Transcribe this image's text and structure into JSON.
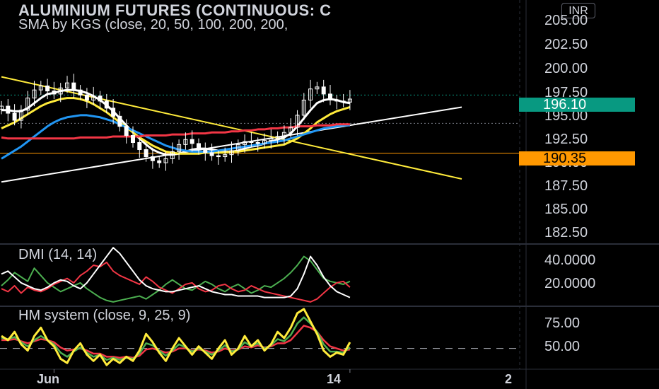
{
  "header": {
    "title": "ALUMINIUM FUTURES (CONTINUOUS: C",
    "indicator": "SMA by KGS (close, 20, 50, 100, 200, 200,",
    "currency": "INR"
  },
  "colors": {
    "background": "#000000",
    "candle": "#ffffff",
    "sma_white": "#ffffff",
    "sma_yellow": "#ffeb3b",
    "sma_blue": "#2196f3",
    "sma_red": "#f23645",
    "trendline_white": "#ffffff",
    "trendline_yellow": "#ffeb3b",
    "level_orange": "#ff9800",
    "last_price_teal": "#089981",
    "dmi_plus": "#4caf50",
    "dmi_minus": "#f23645",
    "adx": "#ffffff",
    "hm_fast": "#ffeb3b",
    "hm_mid": "#4caf50",
    "hm_slow": "#f23645"
  },
  "chart_data": [
    {
      "type": "candlestick",
      "pane": "price",
      "y_ticks": [
        "205.00",
        "202.50",
        "200.00",
        "197.50",
        "195.00",
        "192.50",
        "190.00",
        "187.50",
        "185.00",
        "182.50"
      ],
      "ylim": [
        181.5,
        205.5
      ],
      "last_price": "196.10",
      "last_price_value": 196.1,
      "level": "190.35",
      "level_value": 190.35,
      "close": [
        195.0,
        194.3,
        193.6,
        194.6,
        195.8,
        196.6,
        197.0,
        196.5,
        196.2,
        196.8,
        197.3,
        196.6,
        196.1,
        195.6,
        196.0,
        195.5,
        194.8,
        194.0,
        193.0,
        192.1,
        191.4,
        190.7,
        190.0,
        189.6,
        189.4,
        189.8,
        190.5,
        191.2,
        191.7,
        191.3,
        190.7,
        190.4,
        190.1,
        190.0,
        190.2,
        190.6,
        191.2,
        191.5,
        191.4,
        191.3,
        191.6,
        191.8,
        192.0,
        192.4,
        192.9,
        194.1,
        195.6,
        196.7,
        196.9,
        196.2,
        195.6,
        195.5,
        195.4,
        195.7
      ],
      "trendlines": [
        {
          "color": "white",
          "points": [
            [
              0,
              187.5
            ],
            [
              70,
              194.9
            ]
          ]
        },
        {
          "color": "yellow",
          "points": [
            [
              0,
              197.9
            ],
            [
              70,
              187.8
            ]
          ]
        }
      ],
      "sma_lines": [
        {
          "color": "white",
          "values": [
            194.6,
            194.6,
            194.5,
            194.5,
            194.8,
            195.3,
            195.8,
            196.2,
            196.3,
            196.5,
            196.6,
            196.6,
            196.5,
            196.3,
            196.0,
            195.6,
            195.1,
            194.5,
            193.8,
            193.1,
            192.4,
            191.8,
            191.2,
            190.7,
            190.4,
            190.2,
            190.2,
            190.3,
            190.5,
            190.7,
            190.8,
            190.8,
            190.7,
            190.6,
            190.5,
            190.5,
            190.6,
            190.8,
            191.0,
            191.1,
            191.3,
            191.5,
            191.7,
            191.9,
            192.3,
            193.0,
            193.8,
            194.6,
            195.3,
            195.6,
            195.7,
            195.6,
            195.4,
            195.3
          ]
        },
        {
          "color": "yellow",
          "values": [
            192.8,
            193.1,
            193.4,
            193.8,
            194.2,
            194.6,
            195.0,
            195.3,
            195.5,
            195.7,
            195.8,
            195.8,
            195.7,
            195.5,
            195.2,
            194.8,
            194.4,
            193.9,
            193.4,
            192.9,
            192.4,
            191.9,
            191.5,
            191.1,
            190.8,
            190.5,
            190.4,
            190.3,
            190.3,
            190.3,
            190.3,
            190.4,
            190.4,
            190.4,
            190.4,
            190.5,
            190.5,
            190.6,
            190.7,
            190.8,
            190.9,
            191.0,
            191.1,
            191.2,
            191.5,
            191.8,
            192.3,
            192.8,
            193.4,
            193.8,
            194.2,
            194.5,
            194.7,
            194.9
          ]
        },
        {
          "color": "blue",
          "values": [
            189.8,
            190.2,
            190.6,
            191.0,
            191.5,
            192.0,
            192.5,
            193.0,
            193.4,
            193.7,
            193.9,
            194.0,
            194.1,
            194.1,
            194.0,
            193.9,
            193.7,
            193.5,
            193.2,
            192.9,
            192.6,
            192.3,
            192.0,
            191.7,
            191.4,
            191.1,
            190.9,
            190.7,
            190.6,
            190.5,
            190.5,
            190.5,
            190.5,
            190.6,
            190.7,
            190.8,
            190.9,
            191.0,
            191.1,
            191.2,
            191.3,
            191.4,
            191.5,
            191.6,
            191.8,
            192.0,
            192.2,
            192.4,
            192.6,
            192.8,
            192.9,
            193.0,
            193.1,
            193.1
          ]
        },
        {
          "color": "red",
          "values": [
            191.9,
            191.8,
            191.8,
            191.8,
            191.8,
            191.8,
            191.8,
            191.8,
            191.8,
            191.8,
            191.8,
            191.8,
            191.9,
            191.9,
            191.9,
            191.9,
            191.9,
            192.0,
            192.0,
            192.0,
            192.0,
            192.0,
            192.1,
            192.1,
            192.1,
            192.1,
            192.2,
            192.2,
            192.2,
            192.3,
            192.3,
            192.3,
            192.4,
            192.4,
            192.4,
            192.5,
            192.5,
            192.6,
            192.6,
            192.7,
            192.7,
            192.8,
            192.8,
            192.9,
            192.9,
            193.0,
            193.0,
            193.0,
            193.1,
            193.1,
            193.1,
            193.2,
            193.2,
            193.2
          ]
        }
      ]
    },
    {
      "type": "line",
      "pane": "dmi",
      "title": "DMI (14, 14)",
      "y_ticks": [
        "40.0000",
        "20.0000"
      ],
      "ylim": [
        11,
        52
      ],
      "series": [
        {
          "color": "green",
          "values": [
            24,
            28,
            33,
            30,
            27,
            36,
            31,
            26,
            23,
            20,
            22,
            24,
            26,
            22,
            19,
            16,
            14,
            13,
            14,
            15,
            16,
            17,
            15,
            18,
            21,
            25,
            28,
            25,
            22,
            21,
            24,
            27,
            25,
            22,
            20,
            23,
            25,
            22,
            19,
            21,
            24,
            23,
            26,
            29,
            33,
            38,
            44,
            41,
            35,
            29,
            27,
            26,
            25,
            27
          ]
        },
        {
          "color": "red",
          "values": [
            22,
            20,
            24,
            19,
            23,
            21,
            20,
            22,
            25,
            27,
            29,
            26,
            31,
            34,
            38,
            37,
            40,
            34,
            31,
            29,
            27,
            25,
            30,
            27,
            23,
            21,
            19,
            22,
            25,
            26,
            22,
            20,
            21,
            24,
            25,
            22,
            20,
            21,
            24,
            22,
            20,
            19,
            18,
            17,
            16,
            15,
            14,
            13,
            15,
            19,
            23,
            26,
            27,
            23
          ]
        },
        {
          "color": "white",
          "values": [
            32,
            34,
            30,
            26,
            24,
            22,
            21,
            23,
            26,
            28,
            27,
            24,
            22,
            26,
            32,
            38,
            44,
            50,
            46,
            40,
            34,
            28,
            24,
            22,
            21,
            20,
            20,
            21,
            22,
            23,
            24,
            22,
            20,
            19,
            18,
            18,
            17,
            17,
            17,
            17,
            16,
            16,
            16,
            16,
            17,
            22,
            32,
            44,
            38,
            30,
            24,
            20,
            18,
            16
          ]
        }
      ]
    },
    {
      "type": "line",
      "pane": "hm",
      "title": "HM system (close, 9, 25, 9)",
      "y_ticks": [
        "75.00",
        "50.00"
      ],
      "ylim": [
        30,
        90
      ],
      "reference_line": 50,
      "series": [
        {
          "color": "yellow",
          "values": [
            62,
            58,
            66,
            54,
            48,
            62,
            70,
            58,
            52,
            40,
            36,
            48,
            55,
            44,
            38,
            44,
            34,
            40,
            36,
            42,
            38,
            48,
            64,
            56,
            46,
            38,
            50,
            60,
            52,
            44,
            52,
            46,
            40,
            50,
            58,
            44,
            50,
            62,
            52,
            58,
            48,
            54,
            66,
            60,
            70,
            84,
            88,
            76,
            64,
            48,
            42,
            46,
            44,
            56
          ]
        },
        {
          "color": "green",
          "values": [
            60,
            59,
            61,
            56,
            52,
            58,
            62,
            58,
            54,
            46,
            42,
            47,
            51,
            46,
            42,
            44,
            39,
            41,
            39,
            41,
            40,
            45,
            55,
            53,
            48,
            43,
            48,
            54,
            51,
            47,
            50,
            47,
            44,
            48,
            53,
            47,
            49,
            56,
            52,
            55,
            50,
            53,
            59,
            57,
            63,
            74,
            80,
            74,
            66,
            54,
            47,
            47,
            46,
            51
          ]
        },
        {
          "color": "red",
          "values": [
            58,
            58,
            59,
            57,
            55,
            57,
            59,
            58,
            56,
            51,
            48,
            49,
            50,
            48,
            45,
            45,
            42,
            42,
            41,
            42,
            41,
            43,
            49,
            50,
            48,
            46,
            47,
            50,
            50,
            48,
            49,
            48,
            46,
            47,
            50,
            48,
            49,
            52,
            51,
            53,
            51,
            52,
            55,
            55,
            58,
            65,
            72,
            70,
            66,
            58,
            52,
            50,
            48,
            49
          ]
        }
      ]
    }
  ],
  "x_axis": {
    "labels": [
      {
        "text": "Jun",
        "index": 8
      },
      {
        "text": "14",
        "index": 53
      }
    ],
    "future_label": "2"
  }
}
